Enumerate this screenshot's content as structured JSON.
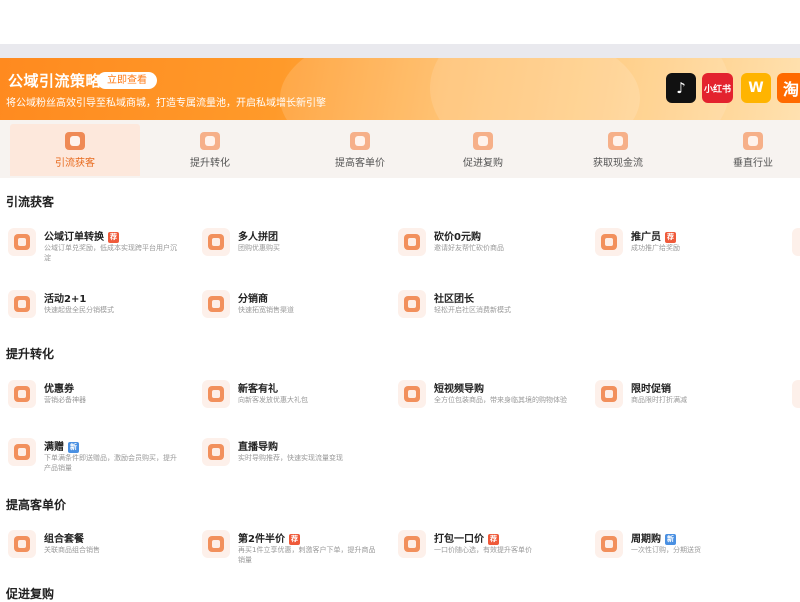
{
  "banner": {
    "title": "公域引流策略",
    "button": "立即查看",
    "subtitle": "将公域粉丝高效引导至私域商城，打造专属流量池，开启私域增长新引擎",
    "platforms": [
      {
        "name": "tiktok-icon",
        "label": "♪",
        "color": "#111111"
      },
      {
        "name": "xiaohongshu-icon",
        "label": "小红书",
        "color": "#e3222e"
      },
      {
        "name": "weibotang-icon",
        "label": "W",
        "color": "#ffb400"
      },
      {
        "name": "taobao-icon",
        "label": "淘",
        "color": "#ff6a00"
      }
    ]
  },
  "tabs": [
    {
      "label": "引流获客",
      "active": true
    },
    {
      "label": "提升转化"
    },
    {
      "label": "提高客单价"
    },
    {
      "label": "促进复购"
    },
    {
      "label": "获取现金流"
    },
    {
      "label": "垂直行业"
    }
  ],
  "sections": [
    {
      "title": "引流获客",
      "items": [
        {
          "name": "公域订单转换",
          "badge": "荐",
          "badge_type": "hot",
          "desc": "公域订单兑奖励，低成本实现跨平台用户沉淀"
        },
        {
          "name": "多人拼团",
          "desc": "团购优惠购买"
        },
        {
          "name": "砍价0元购",
          "desc": "邀请好友帮忙砍价商品"
        },
        {
          "name": "推广员",
          "badge": "荐",
          "badge_type": "hot",
          "desc": "成功推广给奖励"
        },
        {
          "name": "活动2+1",
          "desc": "快速起盘全民分销模式"
        },
        {
          "name": "分销商",
          "desc": "快速拓宽销售渠道"
        },
        {
          "name": "社区团长",
          "desc": "轻松开启社区消费新模式"
        }
      ]
    },
    {
      "title": "提升转化",
      "items": [
        {
          "name": "优惠券",
          "desc": "营销必备神器"
        },
        {
          "name": "新客有礼",
          "desc": "向新客发放优惠大礼包"
        },
        {
          "name": "短视频导购",
          "desc": "全方位包装商品，带来身临其境的购物体验"
        },
        {
          "name": "限时促销",
          "desc": "商品限时打折满减"
        },
        {
          "name": "满赠",
          "badge": "新",
          "badge_type": "new",
          "desc": "下单满条件即送赠品，激励会员购买，提升产品销量"
        },
        {
          "name": "直播导购",
          "desc": "实时导购推荐，快速实现流量变现"
        }
      ]
    },
    {
      "title": "提高客单价",
      "items": [
        {
          "name": "组合套餐",
          "desc": "关联商品组合销售"
        },
        {
          "name": "第2件半价",
          "badge": "荐",
          "badge_type": "hot",
          "desc": "再买1件立享优惠，刺激客户下单，提升商品销量"
        },
        {
          "name": "打包一口价",
          "badge": "荐",
          "badge_type": "hot",
          "desc": "一口价随心选，有效提升客单价"
        },
        {
          "name": "周期购",
          "badge": "新",
          "badge_type": "new",
          "desc": "一次性订购，分期送货"
        }
      ]
    },
    {
      "title": "促进复购",
      "items": []
    }
  ]
}
